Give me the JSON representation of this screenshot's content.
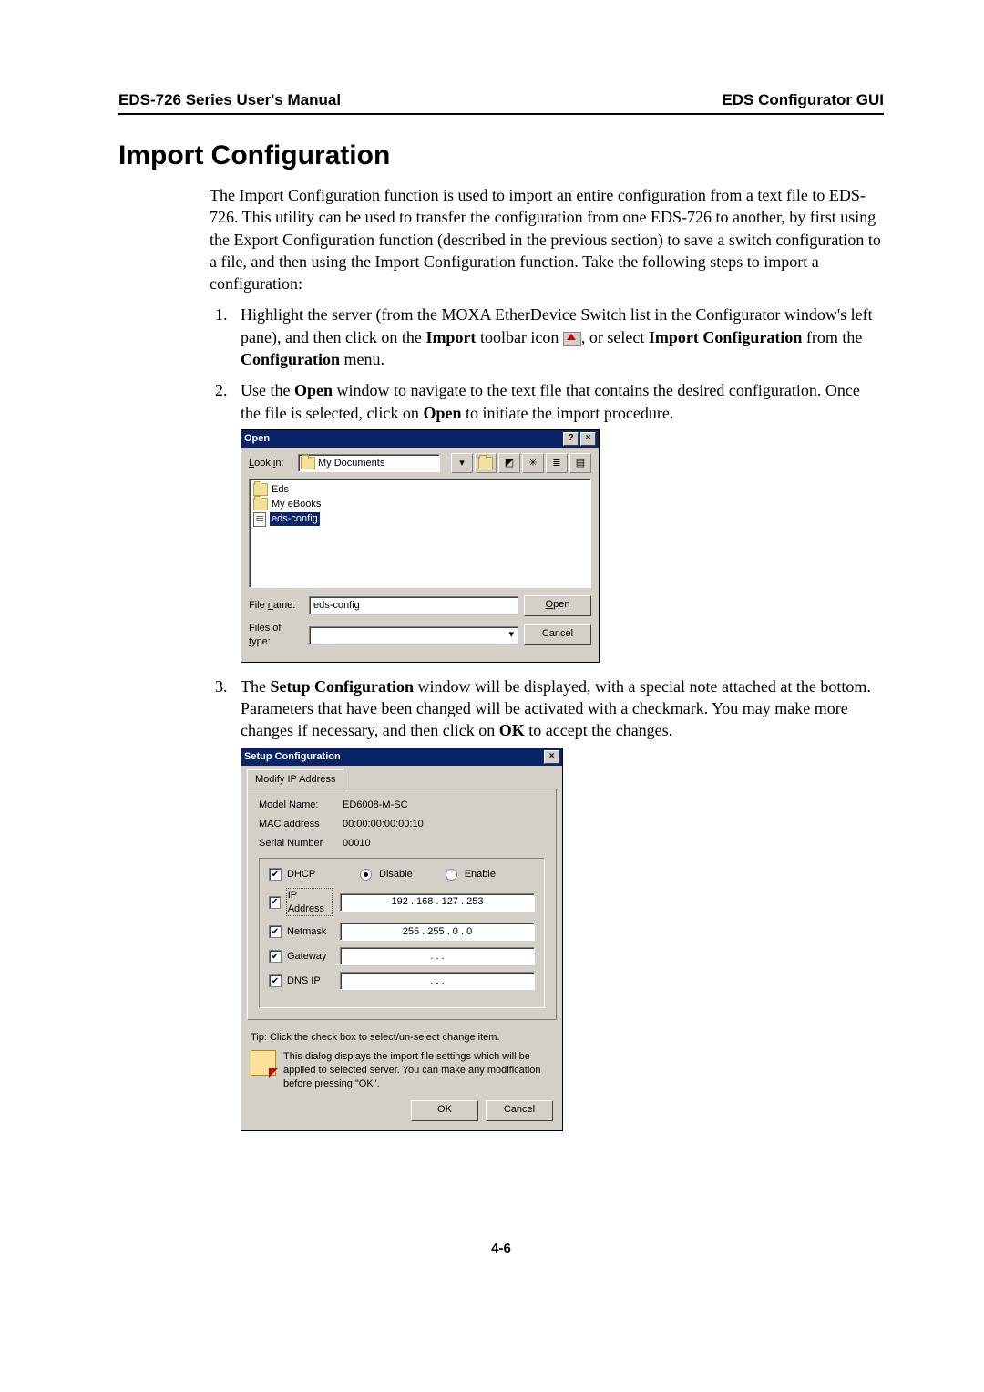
{
  "header": {
    "left": "EDS-726 Series User's Manual",
    "right": "EDS Configurator GUI"
  },
  "section_title": "Import Configuration",
  "intro": "The Import Configuration function is used to import an entire configuration from a text file to EDS-726. This utility can be used to transfer the configuration from one EDS-726 to another, by first using the Export Configuration function (described in the previous section) to save a switch configuration to a file, and then using the Import Configuration function. Take the following steps to import a configuration:",
  "step1": {
    "pre": "Highlight the server (from the MOXA EtherDevice Switch list in the Configurator window's left pane), and then click on the ",
    "bold1": "Import",
    "mid1": " toolbar icon ",
    "mid2": ", or select ",
    "bold2": "Import Configuration",
    "post": " from the ",
    "bold3": "Configuration",
    "end": " menu."
  },
  "step2": {
    "pre": "Use the ",
    "bold1": "Open",
    "mid1": " window to navigate to the text file that contains the desired configuration. Once the file is selected, click on ",
    "bold2": "Open",
    "post": " to initiate the import procedure."
  },
  "open_dialog": {
    "title": "Open",
    "lookin_label": "Look in:",
    "lookin_value": "My Documents",
    "files": {
      "f1": "Eds",
      "f2": "My eBooks",
      "f3": "eds-config"
    },
    "filename_label": "File name:",
    "filename_value": "eds-config",
    "filetype_label": "Files of type:",
    "filetype_value": "",
    "open_btn": "Open",
    "cancel_btn": "Cancel"
  },
  "step3": {
    "pre": "The ",
    "bold1": "Setup Configuration",
    "mid1": " window will be displayed, with a special note attached at the bottom. Parameters that have been changed will be activated with a checkmark. You may make more changes if necessary, and then click on ",
    "bold2": "OK",
    "post": " to accept the changes."
  },
  "setup_dialog": {
    "title": "Setup Configuration",
    "tab": "Modify IP Address",
    "model_name_k": "Model Name:",
    "model_name_v": "ED6008-M-SC",
    "mac_k": "MAC address",
    "mac_v": "00:00:00:00:00:10",
    "serial_k": "Serial Number",
    "serial_v": "00010",
    "dhcp_label": "DHCP",
    "disable": "Disable",
    "enable": "Enable",
    "ip_label": "IP Address",
    "ip_value": "192 . 168 . 127 . 253",
    "netmask_label": "Netmask",
    "netmask_value": "255 . 255 .  0  .  0",
    "gateway_label": "Gateway",
    "gateway_value": " .   .   . ",
    "dns_label": "DNS IP",
    "dns_value": " .   .   . ",
    "tip": "Tip: Click the check box to select/un-select change item.",
    "note": "This dialog displays the import file settings which will be applied to selected server. You can make any modification before pressing \"OK\".",
    "ok_btn": "OK",
    "cancel_btn": "Cancel"
  },
  "page_number": "4-6"
}
